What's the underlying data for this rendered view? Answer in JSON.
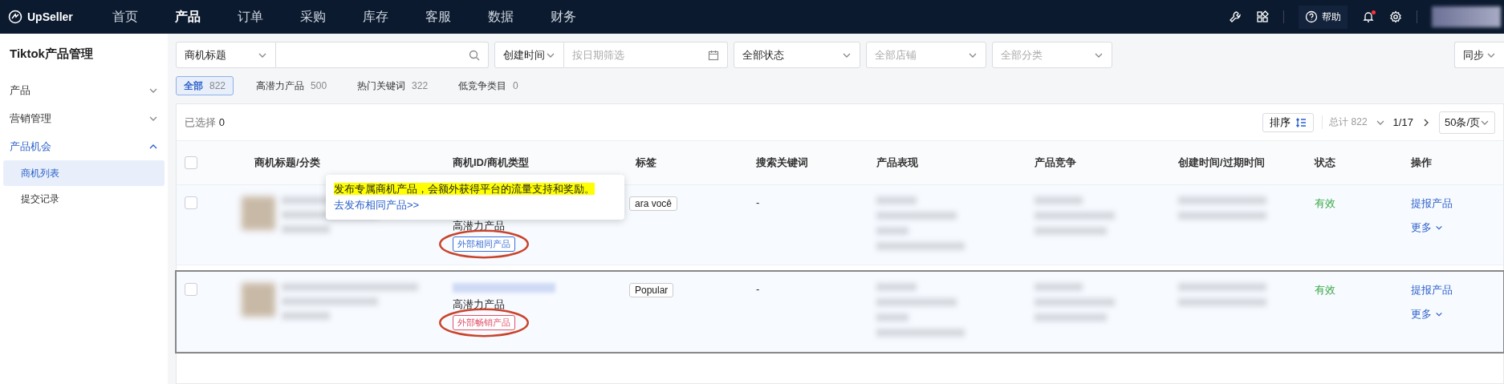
{
  "top_nav": {
    "logo": "UpSeller",
    "items": [
      {
        "label": "首页",
        "selected": false
      },
      {
        "label": "产品",
        "selected": true
      },
      {
        "label": "订单",
        "selected": false
      },
      {
        "label": "采购",
        "selected": false
      },
      {
        "label": "库存",
        "selected": false
      },
      {
        "label": "客服",
        "selected": false
      },
      {
        "label": "数据",
        "selected": false
      },
      {
        "label": "财务",
        "selected": false
      }
    ],
    "help": "帮助",
    "notification_dot": true
  },
  "sidebar": {
    "title": "Tiktok产品管理",
    "groups": [
      {
        "label": "产品",
        "expanded": false
      },
      {
        "label": "营销管理",
        "expanded": false
      },
      {
        "label": "产品机会",
        "expanded": true,
        "children": [
          {
            "label": "商机列表",
            "selected": true
          },
          {
            "label": "提交记录",
            "selected": false
          }
        ]
      }
    ]
  },
  "filters": {
    "search_type": "商机标题",
    "date_type": "创建时间",
    "date_placeholder": "按日期筛选",
    "status": "全部状态",
    "shop_placeholder": "全部店铺",
    "category_placeholder": "全部分类",
    "sync": "同步"
  },
  "chips": [
    {
      "label": "全部",
      "count": "822",
      "selected": true
    },
    {
      "label": "高潜力产品",
      "count": "500",
      "selected": false
    },
    {
      "label": "热门关键词",
      "count": "322",
      "selected": false
    },
    {
      "label": "低竞争类目",
      "count": "0",
      "selected": false
    }
  ],
  "toolbar": {
    "selected_label": "已选择",
    "selected_count": "0",
    "sort": "排序",
    "total": "总计 822",
    "page": "1/17",
    "page_size": "50条/页"
  },
  "table": {
    "select_all_checked": false,
    "columns": [
      "商机标题/分类",
      "商机ID/商机类型",
      "标签",
      "搜索关键词",
      "产品表现",
      "产品竞争",
      "创建时间/过期时间",
      "状态",
      "操作"
    ],
    "rows": [
      {
        "checked": false,
        "highlighted": false,
        "show_id": false,
        "type": "高潜力产品",
        "source_tag": {
          "label": "外部相同产品",
          "color": "#3a6fd8"
        },
        "label": "ara você",
        "keyword": "-",
        "status": "有效",
        "action": "提报产品",
        "more": "更多"
      },
      {
        "checked": false,
        "highlighted": true,
        "show_id": true,
        "type": "高潜力产品",
        "source_tag": {
          "label": "外部畅销产品",
          "color": "#e0506a"
        },
        "label": "Popular",
        "keyword": "-",
        "status": "有效",
        "action": "提报产品",
        "more": "更多"
      }
    ]
  },
  "tooltip": {
    "text": "发布专属商机产品，会额外获得平台的流量支持和奖励。",
    "link": "去发布相同产品>>"
  }
}
